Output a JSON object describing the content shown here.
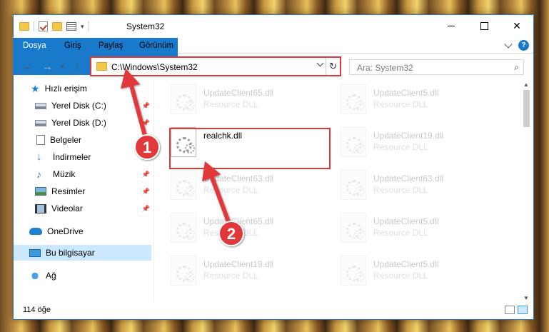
{
  "window": {
    "title": "System32",
    "status_count": "114 öğe"
  },
  "ribbon": {
    "tabs": [
      "Dosya",
      "Giriş",
      "Paylaş",
      "Görünüm"
    ],
    "help": "?"
  },
  "address": {
    "path": "C:\\Windows\\System32",
    "search_placeholder": "Ara: System32"
  },
  "navigation": {
    "items": [
      {
        "label": "Hızlı erişim",
        "icon": "star-icon",
        "pinned": false
      },
      {
        "label": "Yerel Disk (C:)",
        "icon": "drive-icon",
        "pinned": true
      },
      {
        "label": "Yerel Disk (D:)",
        "icon": "drive-icon",
        "pinned": true
      },
      {
        "label": "Belgeler",
        "icon": "documents-icon",
        "pinned": true
      },
      {
        "label": "İndirmeler",
        "icon": "download-icon",
        "pinned": true
      },
      {
        "label": "Müzik",
        "icon": "music-icon",
        "pinned": true
      },
      {
        "label": "Resimler",
        "icon": "pictures-icon",
        "pinned": true
      },
      {
        "label": "Videolar",
        "icon": "videos-icon",
        "pinned": true
      },
      {
        "label": "OneDrive",
        "icon": "cloud-icon",
        "pinned": false
      },
      {
        "label": "Bu bilgisayar",
        "icon": "computer-icon",
        "pinned": false,
        "selected": true
      },
      {
        "label": "Ağ",
        "icon": "network-icon",
        "pinned": false
      }
    ]
  },
  "files": [
    {
      "name": "UpdateClient65.dll",
      "desc": "Resource DLL",
      "faded": true
    },
    {
      "name": "UpdateClient5.dll",
      "desc": "Resource DLL",
      "faded": true
    },
    {
      "name": "realchk.dll",
      "desc": "",
      "faded": false,
      "highlighted": true
    },
    {
      "name": "UpdateClient19.dll",
      "desc": "Resource DLL",
      "faded": true
    },
    {
      "name": "UpdateClient63.dll",
      "desc": "Resource DLL",
      "faded": true
    },
    {
      "name": "UpdateClient63.dll",
      "desc": "Resource DLL",
      "faded": true
    },
    {
      "name": "UpdateClient65.dll",
      "desc": "Resource DLL",
      "faded": true
    },
    {
      "name": "UpdateClient5.dll",
      "desc": "Resource DLL",
      "faded": true
    },
    {
      "name": "UpdateClient19.dll",
      "desc": "Resource DLL",
      "faded": true
    },
    {
      "name": "UpdateClient5.dll",
      "desc": "Resource DLL",
      "faded": true
    }
  ],
  "annotations": {
    "step1": "1",
    "step2": "2",
    "color": "#e0373a"
  }
}
